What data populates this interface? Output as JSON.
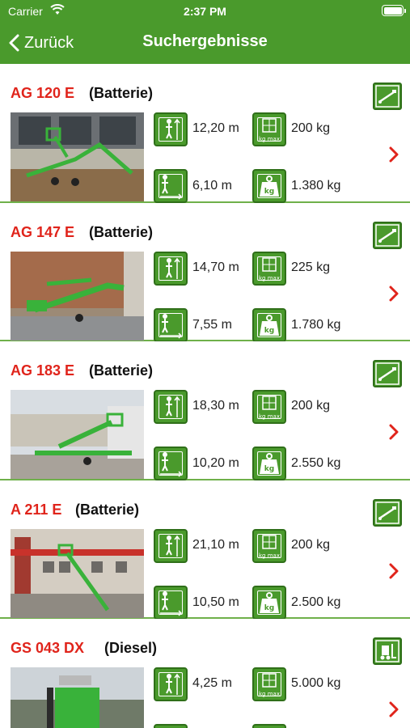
{
  "status_bar": {
    "carrier": "Carrier",
    "time": "2:37 PM"
  },
  "nav": {
    "back_label": "Zurück",
    "title": "Suchergebnisse"
  },
  "colors": {
    "brand_green": "#4a9a2c",
    "name_red": "#e0241b"
  },
  "results": [
    {
      "name": "AG 120 E",
      "power": "(Batterie)",
      "type_icon": "platform-arm-icon",
      "height": "12,20 m",
      "capacity": "200 kg",
      "reach": "6,10 m",
      "weight": "1.380 kg"
    },
    {
      "name": "AG 147 E",
      "power": "(Batterie)",
      "type_icon": "platform-arm-icon",
      "height": "14,70 m",
      "capacity": "225 kg",
      "reach": "7,55 m",
      "weight": "1.780 kg"
    },
    {
      "name": "AG 183 E",
      "power": "(Batterie)",
      "type_icon": "platform-arm-icon",
      "height": "18,30 m",
      "capacity": "200 kg",
      "reach": "10,20 m",
      "weight": "2.550 kg"
    },
    {
      "name": "A 211 E",
      "power": "(Batterie)",
      "type_icon": "platform-arm-icon",
      "height": "21,10 m",
      "capacity": "200 kg",
      "reach": "10,50 m",
      "weight": "2.500 kg"
    },
    {
      "name": "GS 043 DX",
      "power": "(Diesel)",
      "type_icon": "forklift-icon",
      "height": "4,25 m",
      "capacity": "5.000 kg",
      "reach": "",
      "weight": ""
    }
  ]
}
